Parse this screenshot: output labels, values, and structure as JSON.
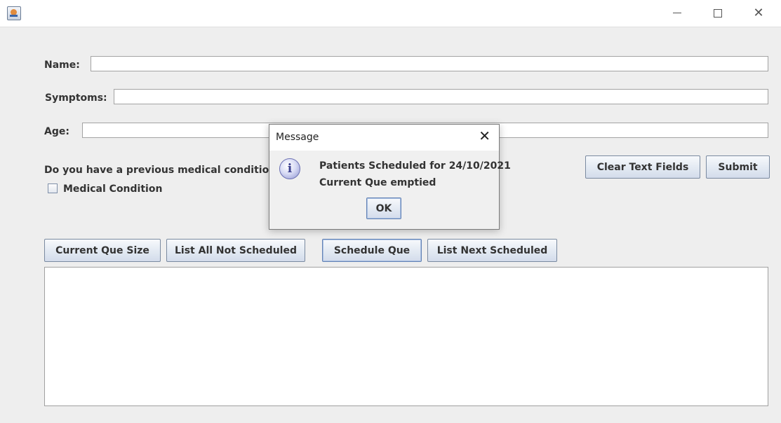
{
  "window": {
    "title": "",
    "controls": {
      "minimize": "minimize-icon",
      "maximize": "maximize-icon",
      "close": "close-icon"
    }
  },
  "form": {
    "name_label": "Name:",
    "name_value": "",
    "symptoms_label": "Symptoms:",
    "symptoms_value": "",
    "age_label": "Age:",
    "age_value": "",
    "question": "Do you have a previous medical condition?",
    "checkbox_label": "Medical Condition",
    "checkbox_checked": false,
    "clear_button": "Clear Text Fields",
    "submit_button": "Submit"
  },
  "actions": {
    "current_que_size": "Current Que Size",
    "list_all_not_scheduled": "List All Not Scheduled",
    "schedule_que": "Schedule Que",
    "list_next_scheduled": "List Next Scheduled"
  },
  "output": {
    "text": ""
  },
  "dialog": {
    "title": "Message",
    "line1": "Patients Scheduled for 24/10/2021",
    "line2": "Current Que emptied",
    "ok_button": "OK",
    "icon": "info-icon"
  }
}
